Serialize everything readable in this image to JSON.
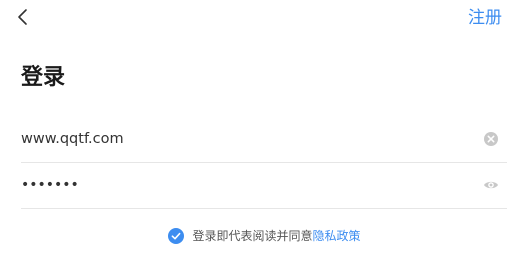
{
  "header": {
    "back_icon": "chevron-left-icon",
    "register_label": "注册"
  },
  "title": "登录",
  "username": {
    "value": "www.qqtf.com",
    "clear_icon": "clear-circle-icon"
  },
  "password": {
    "value": "1234567",
    "visibility_icon": "eye-icon"
  },
  "agreement": {
    "checked": true,
    "text": "登录即代表阅读并同意",
    "link_label": "隐私政策",
    "accent_color": "#3d8df0"
  },
  "colors": {
    "accent": "#3d8df0",
    "title": "#1a1a1a",
    "divider": "#e6e6e6",
    "icon_gray": "#c8c8c8"
  }
}
